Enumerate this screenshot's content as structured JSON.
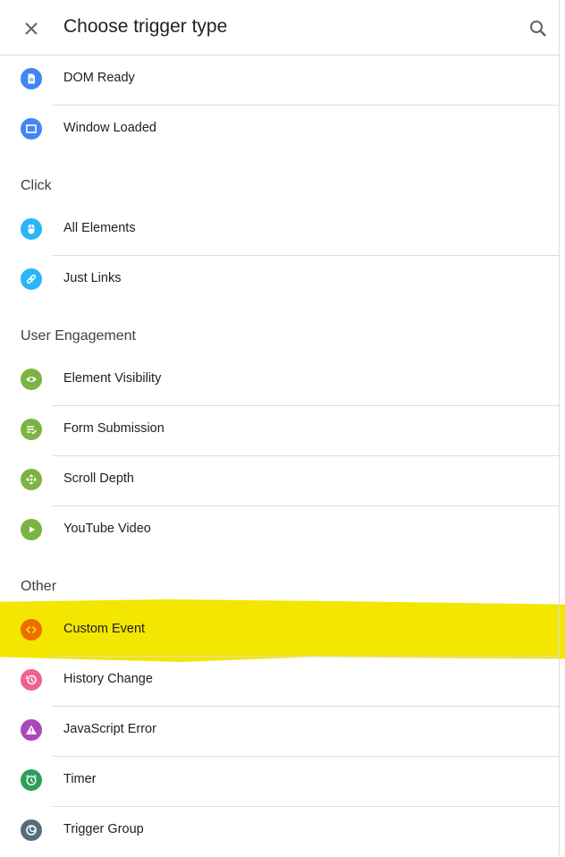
{
  "header": {
    "title": "Choose trigger type",
    "close_icon": "close-icon",
    "search_icon": "search-icon"
  },
  "sections": [
    {
      "title": "",
      "items": [
        {
          "label": "DOM Ready",
          "icon": "document-icon",
          "color": "#4285f4"
        },
        {
          "label": "Window Loaded",
          "icon": "window-icon",
          "color": "#4285f4"
        }
      ]
    },
    {
      "title": "Click",
      "items": [
        {
          "label": "All Elements",
          "icon": "mouse-icon",
          "color": "#29b6f6"
        },
        {
          "label": "Just Links",
          "icon": "link-icon",
          "color": "#29b6f6"
        }
      ]
    },
    {
      "title": "User Engagement",
      "items": [
        {
          "label": "Element Visibility",
          "icon": "eye-icon",
          "color": "#7cb342"
        },
        {
          "label": "Form Submission",
          "icon": "form-check-icon",
          "color": "#7cb342"
        },
        {
          "label": "Scroll Depth",
          "icon": "move-arrows-icon",
          "color": "#7cb342"
        },
        {
          "label": "YouTube Video",
          "icon": "play-icon",
          "color": "#7cb342"
        }
      ]
    },
    {
      "title": "Other",
      "items": [
        {
          "label": "Custom Event",
          "icon": "code-icon",
          "color": "#ef6c00",
          "highlighted": true
        },
        {
          "label": "History Change",
          "icon": "history-icon",
          "color": "#f06292"
        },
        {
          "label": "JavaScript Error",
          "icon": "warning-icon",
          "color": "#ab47bc"
        },
        {
          "label": "Timer",
          "icon": "alarm-icon",
          "color": "#2e9e5b"
        },
        {
          "label": "Trigger Group",
          "icon": "trigger-group-icon",
          "color": "#546e7a"
        }
      ]
    }
  ]
}
